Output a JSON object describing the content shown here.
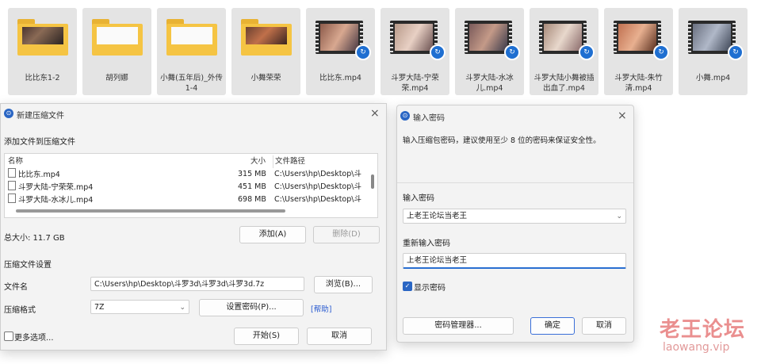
{
  "files": [
    {
      "name": "比比东1-2",
      "kind": "folder",
      "style": "photo-dark"
    },
    {
      "name": "胡列娜",
      "kind": "folder",
      "style": "paper"
    },
    {
      "name": "小舞(五年后)_外传 1-4",
      "kind": "folder",
      "style": "paper"
    },
    {
      "name": "小舞荣荣",
      "kind": "folder",
      "style": "photo"
    },
    {
      "name": "比比东.mp4",
      "kind": "video"
    },
    {
      "name": "斗罗大陆-宁荣荣.mp4",
      "kind": "video"
    },
    {
      "name": "斗罗大陆-水冰儿.mp4",
      "kind": "video"
    },
    {
      "name": "斗罗大陆小舞被插出血了.mp4",
      "kind": "video"
    },
    {
      "name": "斗罗大陆-朱竹清.mp4",
      "kind": "video"
    },
    {
      "name": "小舞.mp4",
      "kind": "video"
    }
  ],
  "compress_dialog": {
    "title": "新建压缩文件",
    "add_files_label": "添加文件到压缩文件",
    "columns": {
      "name": "名称",
      "size": "大小",
      "path": "文件路径"
    },
    "rows": [
      {
        "name": "比比东.mp4",
        "size": "315 MB",
        "path": "C:\\Users\\hp\\Desktop\\斗"
      },
      {
        "name": "斗罗大陆-宁荣荣.mp4",
        "size": "451 MB",
        "path": "C:\\Users\\hp\\Desktop\\斗"
      },
      {
        "name": "斗罗大陆-水冰儿.mp4",
        "size": "698 MB",
        "path": "C:\\Users\\hp\\Desktop\\斗"
      }
    ],
    "total_size": "总大小: 11.7 GB",
    "add_button": "添加(A)",
    "delete_button": "删除(D)",
    "settings_label": "压缩文件设置",
    "filename_label": "文件名",
    "filename_value": "C:\\Users\\hp\\Desktop\\斗罗3d\\斗罗3d\\斗罗3d.7z",
    "browse_button": "浏览(B)...",
    "format_label": "压缩格式",
    "format_value": "7Z",
    "set_password_button": "设置密码(P)...",
    "help_link": "[帮助]",
    "more_options_label": "更多选项...",
    "start_button": "开始(S)",
    "cancel_button": "取消"
  },
  "password_dialog": {
    "title": "输入密码",
    "instruction": "输入压缩包密码，建议使用至少 8 位的密码来保证安全性。",
    "enter_label": "输入密码",
    "enter_value": "上老王论坛当老王",
    "reenter_label": "重新输入密码",
    "reenter_value": "上老王论坛当老王",
    "show_password_label": "显示密码",
    "manager_button": "密码管理器...",
    "ok_button": "确定",
    "cancel_button": "取消"
  },
  "watermark": {
    "title": "老王论坛",
    "url": "laowang.vip"
  },
  "colors": {
    "accent": "#2a66c4",
    "folder": "#f5c443",
    "watermark": "#e88a8a"
  }
}
